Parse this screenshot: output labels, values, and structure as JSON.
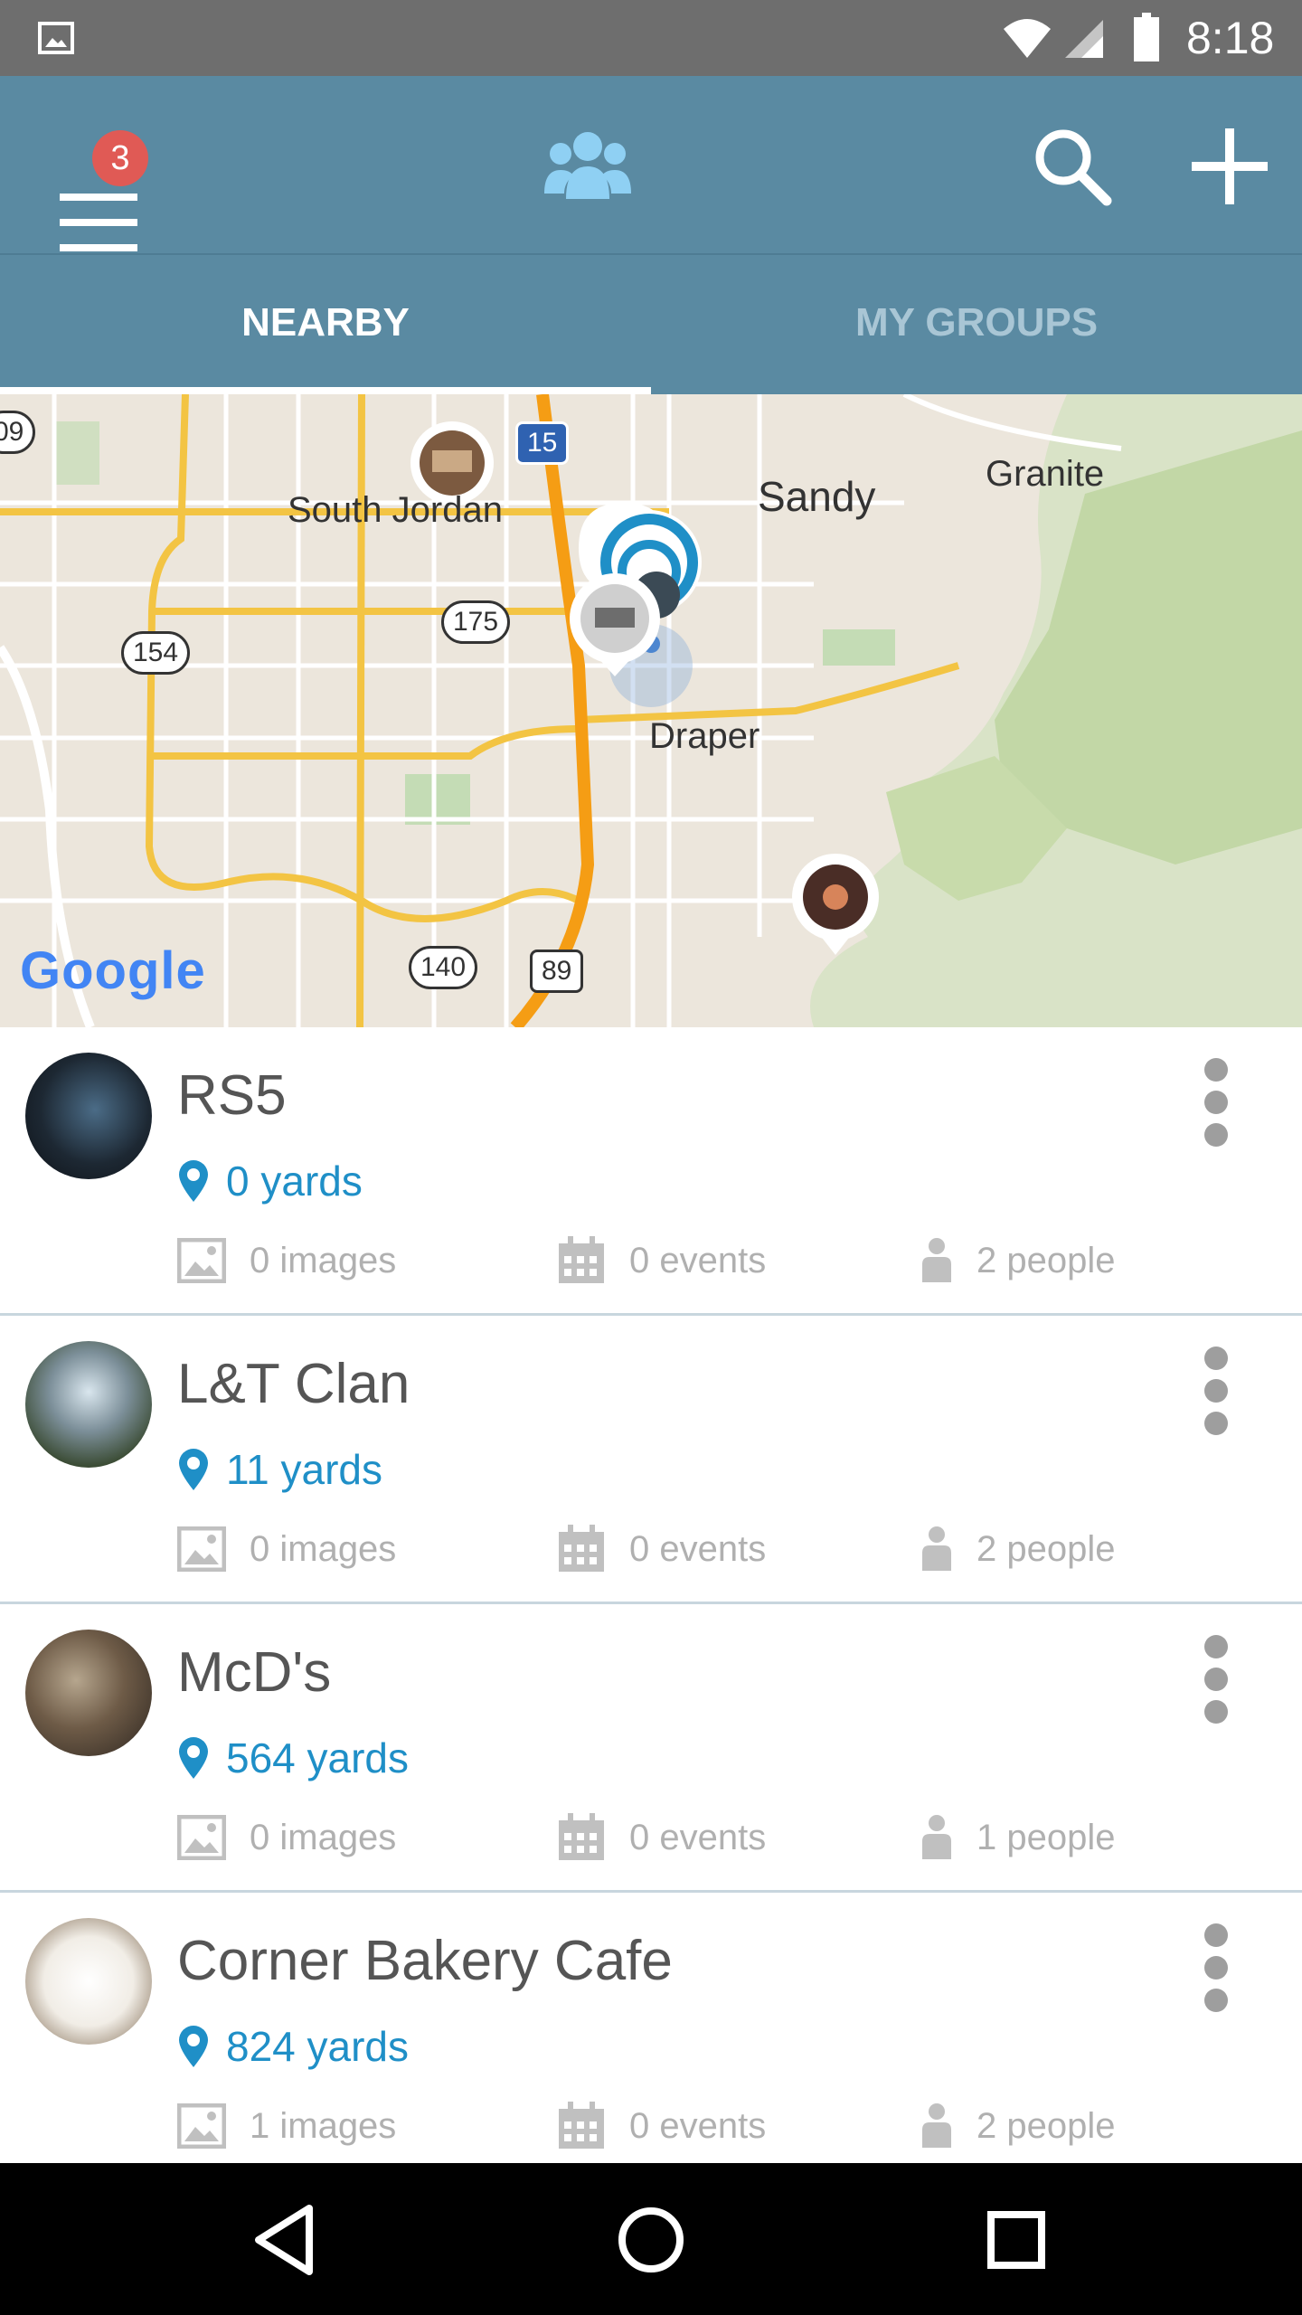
{
  "status_bar": {
    "time": "8:18",
    "icons": [
      "image-icon",
      "wifi-icon",
      "signal-icon",
      "battery-icon"
    ]
  },
  "app_bar": {
    "menu_badge": "3",
    "icons": [
      "menu-icon",
      "groups-icon",
      "search-icon",
      "add-icon"
    ]
  },
  "tabs": [
    {
      "label": "NEARBY",
      "active": true
    },
    {
      "label": "MY GROUPS",
      "active": false
    }
  ],
  "map": {
    "places": [
      "South Jordan",
      "Sandy",
      "Granite",
      "Draper"
    ],
    "routes": [
      "15",
      "175",
      "154",
      "140",
      "89",
      "09"
    ],
    "brand": "Google"
  },
  "groups": [
    {
      "name": "RS5",
      "distance": "0 yards",
      "images": "0 images",
      "events": "0 events",
      "people": "2 people"
    },
    {
      "name": "L&T Clan",
      "distance": "11 yards",
      "images": "0 images",
      "events": "0 events",
      "people": "2 people"
    },
    {
      "name": "McD's",
      "distance": "564 yards",
      "images": "0 images",
      "events": "0 events",
      "people": "1 people"
    },
    {
      "name": "Corner Bakery Cafe",
      "distance": "824 yards",
      "images": "1 images",
      "events": "0 events",
      "people": "2 people"
    }
  ],
  "colors": {
    "app_bar": "#5a8aa2",
    "accent_blue": "#1f8fc7",
    "badge": "#e05a55",
    "nav_bar": "#000000"
  }
}
